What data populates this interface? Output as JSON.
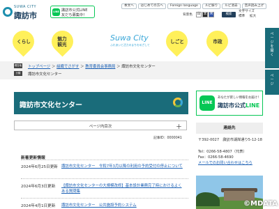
{
  "header": {
    "logo_en": "SUWA CITY",
    "logo_jp": "諏訪市",
    "line_promo": {
      "icon": "LINE",
      "line1": "諏訪市公式LINE",
      "line2": "友だち募集中！"
    },
    "top_links": [
      "本文へ",
      "はじめての方へ",
      "Foreign language",
      "ルビ振り",
      "ルビ消去",
      "音声読み上げ"
    ],
    "display_label": "背景色",
    "swatches": [
      "白",
      "黒",
      "青"
    ],
    "text_size_label": "文字サイズ",
    "text_size_buttons": [
      "標準",
      "拡大"
    ],
    "search_label": "検索"
  },
  "nav": {
    "items": [
      {
        "label": "くらし"
      },
      {
        "label": "魅力\n観光"
      },
      {
        "label": "しごと"
      },
      {
        "label": "市政"
      }
    ],
    "brand": "Suwa City",
    "brand_sub": "ふれあいと活力のまちをめざして"
  },
  "side_tabs": [
    "ページを開く",
    "ページ"
  ],
  "breadcrumb": {
    "badge_current": "現在地",
    "badge_category": "分類",
    "path": [
      "トップページ",
      "組織でさがす",
      "教育委員会事務局",
      "諏訪市文化センター"
    ],
    "category": "諏訪市文化センター"
  },
  "page": {
    "title": "諏訪市文化センター",
    "toc_label": "ページ内目次",
    "toc_toggle": "＋",
    "article_id": "記事ID：0000041"
  },
  "updates": {
    "heading": "新着更新情報",
    "items": [
      {
        "date": "2024年6月25日更新",
        "text": "諏訪市文化センター　令和7年3月以降の利用の予約受付の停止について"
      },
      {
        "date": "2024年6月3日更新",
        "text": "【諏訪市文化センターの大規模改修】基本設計業務完了時におけるよくある質問集"
      },
      {
        "date": "2024年4月1日更新",
        "text": "諏訪市文化センター　公共施設予約システム"
      }
    ]
  },
  "right": {
    "line_banner": {
      "icon": "LINE",
      "sub": "あなたが欲しい情報をお届け！",
      "title_a": "諏訪市公式",
      "title_b": "LINE"
    },
    "contact_heading": "連絡先",
    "contact_lines": [
      "〒392-0027　諏訪市湖岸通り5-12-18",
      "Tel：0266-58-4807（代表）",
      "Fax：0266-58-4690"
    ],
    "mail_link": "メールでのお問い合わせはこちら"
  },
  "credit": "©MDATA",
  "colors": {
    "accent": "#1a6c7a",
    "line_green": "#06c755",
    "nav_yellow": "#fff05a",
    "link": "#1a5fb4"
  }
}
